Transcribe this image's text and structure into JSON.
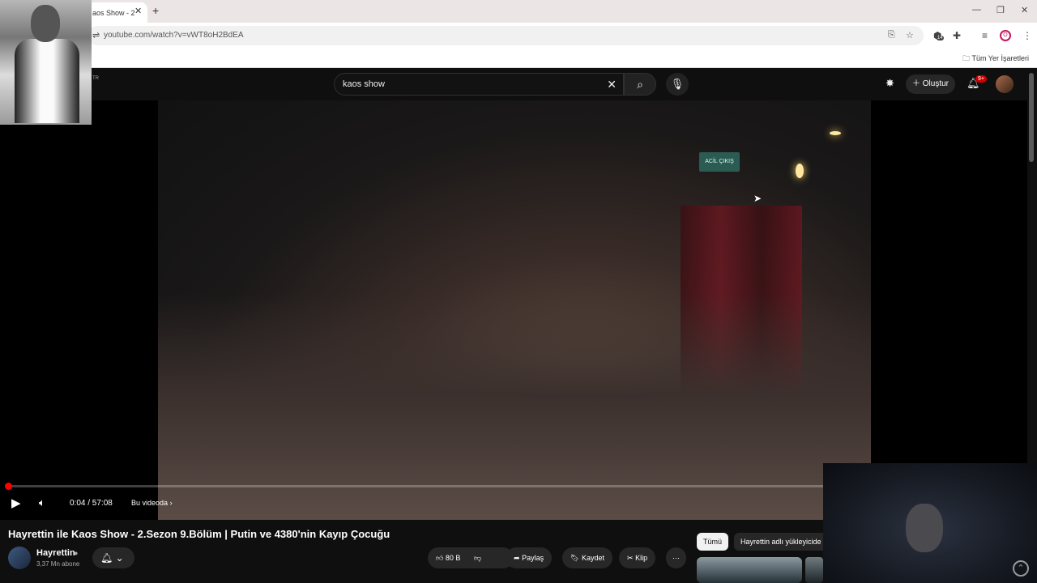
{
  "browser": {
    "tab_title": "aos Show - 2",
    "url": "youtube.com/watch?v=vWT8oH2BdEA",
    "bookmarks_label": "Tüm Yer İşaretleri",
    "extensions_badge": "14",
    "profile_initial": "O"
  },
  "youtube": {
    "header_fragment": "TR",
    "search_value": "kaos show",
    "create_label": "Oluştur",
    "notifications_badge": "9+"
  },
  "player": {
    "time": "0:04 / 57:08",
    "chapter_label": "Bu videoda",
    "exit_sign": "ACİL ÇIKIŞ",
    "progress_fraction": 0.0012
  },
  "video": {
    "title": "Hayrettin ile Kaos Show - 2.Sezon 9.Bölüm | Putin ve 4380'nin Kayıp Çocuğu",
    "channel": "Hayrettin",
    "subscribers": "3,37 Mn abone",
    "likes": "80 B",
    "share_label": "Paylaş",
    "save_label": "Kaydet",
    "clip_label": "Klip"
  },
  "sidebar": {
    "chips": [
      "Tümü",
      "Hayrettin adlı yükleyicide"
    ]
  },
  "colors": {
    "accent": "#ff0000",
    "bg": "#0f0f0f"
  }
}
